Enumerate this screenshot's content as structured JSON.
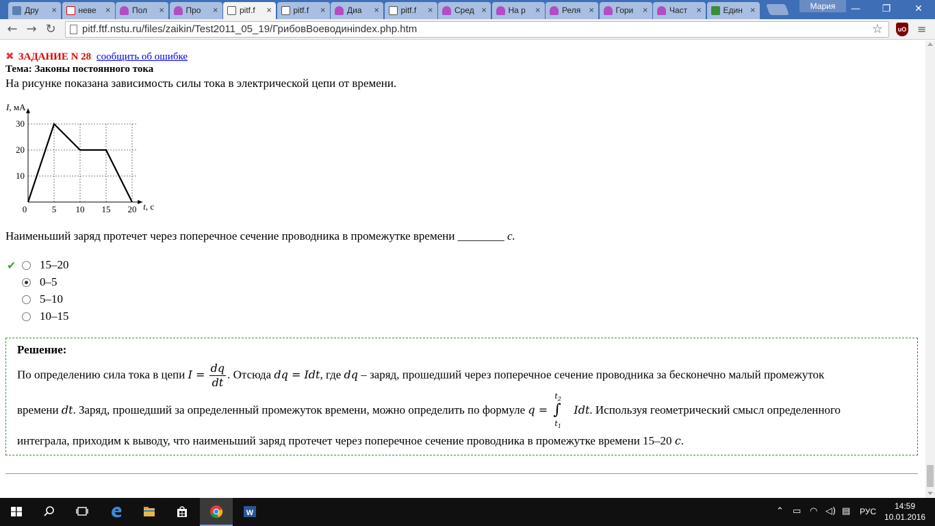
{
  "browser": {
    "tabs": [
      {
        "label": "Дру",
        "favicon": "vk-icon"
      },
      {
        "label": "неве",
        "favicon": "yandex-icon"
      },
      {
        "label": "Пол",
        "favicon": "book-icon"
      },
      {
        "label": "Про",
        "favicon": "book-icon"
      },
      {
        "label": "pitf.f",
        "favicon": "pitf-icon",
        "active": true
      },
      {
        "label": "pitf.f",
        "favicon": "pitf-icon"
      },
      {
        "label": "Диа",
        "favicon": "book-icon"
      },
      {
        "label": "pitf.f",
        "favicon": "pitf-icon"
      },
      {
        "label": "Сред",
        "favicon": "book-icon"
      },
      {
        "label": "На р",
        "favicon": "book-icon"
      },
      {
        "label": "Реля",
        "favicon": "book-icon"
      },
      {
        "label": "Гори",
        "favicon": "book-icon"
      },
      {
        "label": "Част",
        "favicon": "book-icon"
      },
      {
        "label": "Един",
        "favicon": "edu-icon"
      }
    ],
    "profile_name": "Мария",
    "url": "pitf.ftf.nstu.ru/files/zaikin/Test2011_05_19/ГрибовВоеводинindex.php.htm"
  },
  "task": {
    "number_label": "ЗАДАНИЕ N 28",
    "report_link": "сообщить об ошибке",
    "topic": "Тема: Законы постоянного тока",
    "question": "На рисунке показана зависимость силы тока в электрической цепи от времени.",
    "statement_main": "Наименьший заряд протечет через поперечное сечение проводника  в промежутке времени ________ ",
    "statement_unit": "с."
  },
  "chart_data": {
    "type": "line",
    "x": [
      0,
      5,
      10,
      15,
      20
    ],
    "y": [
      0,
      30,
      20,
      20,
      0
    ],
    "xlabel": "t, с",
    "ylabel": "I, мА",
    "x_ticks": [
      "0",
      "5",
      "10",
      "15",
      "20"
    ],
    "y_ticks": [
      "10",
      "20",
      "30"
    ],
    "xlim": [
      0,
      22
    ],
    "ylim": [
      0,
      36
    ],
    "grid": true
  },
  "answers": [
    {
      "label": "15–20",
      "correct": true,
      "selected": false
    },
    {
      "label": "0–5",
      "correct": false,
      "selected": true
    },
    {
      "label": "5–10",
      "correct": false,
      "selected": false
    },
    {
      "label": "10–15",
      "correct": false,
      "selected": false
    }
  ],
  "solution": {
    "title": "Решение:",
    "l1_a": "По определению сила тока в цепи ",
    "f_I": "I =",
    "f_num": "dq",
    "f_den": "dt",
    "l1_b": ". Отсюда ",
    "f_dq": "dq = Idt",
    "l1_c": ", где ",
    "f_dq2": "dq",
    "l1_d": " – заряд, прошедший через поперечное сечение проводника за бесконечно малый промежуток",
    "l2_a": "времени ",
    "f_dt": "dt",
    "l2_b": ". Заряд, прошедший за определенный промежуток времени, можно определить по формуле ",
    "f_q": "q =",
    "f_int_upper": "t2",
    "f_int_lower": "t1",
    "f_int_body": "Idt",
    "l2_c": ". Используя геометрический смысл определенного",
    "l3_a": "интеграла, приходим к выводу, что наименьший заряд протечет через поперечное сечение проводника  в промежутке времени 15–20 ",
    "l3_unit": "с",
    "l3_end": "."
  },
  "taskbar": {
    "lang": "РУС",
    "time": "14:59",
    "date": "10.01.2016"
  }
}
